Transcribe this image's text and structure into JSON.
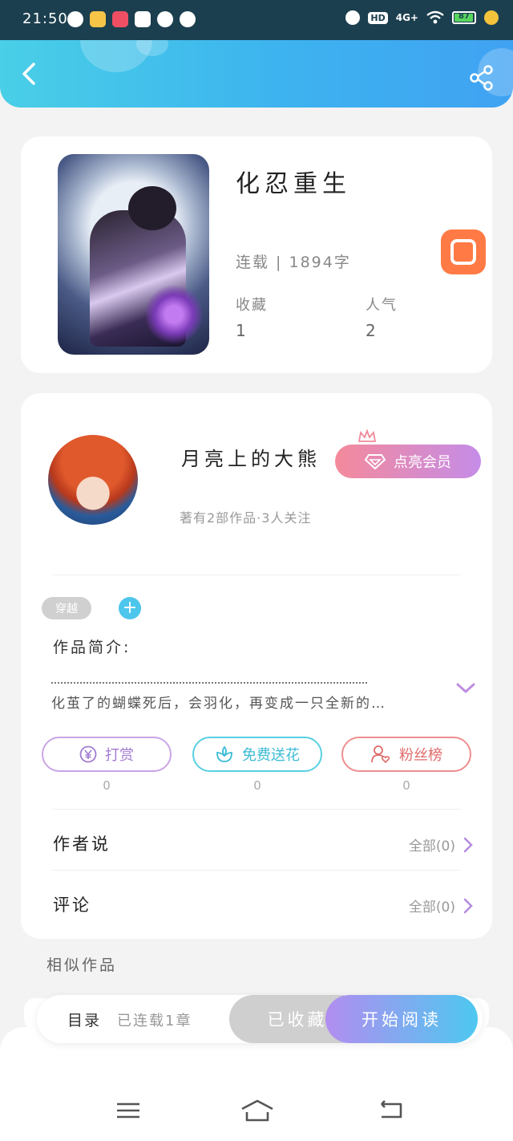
{
  "status_bar": {
    "time": "21:50",
    "network": "4G+",
    "hd": "HD",
    "battery": "87",
    "battery_fill": 0.87
  },
  "header": {
    "back_icon": "chevron-left-icon",
    "share_icon": "share-icon"
  },
  "book": {
    "title": "化忍重生",
    "meta": "连载 | 1894字",
    "stats": [
      {
        "label": "收藏",
        "value": "1"
      },
      {
        "label": "人气",
        "value": "2"
      }
    ],
    "app_badge_icon": "kuaishou-icon"
  },
  "author": {
    "name": "月亮上的大熊",
    "subtitle": "著有2部作品·3人关注",
    "vip_label": "点亮会员",
    "vip_icon": "diamond-icon",
    "crown_icon": "crown-icon"
  },
  "tags": {
    "items": [
      "穿越"
    ],
    "add_label": "+"
  },
  "intro": {
    "label": "作品简介:",
    "text": "化茧了的蝴蝶死后，会羽化，再变成一只全新的…",
    "expand_icon": "chevron-down-icon"
  },
  "actions": [
    {
      "label": "打赏",
      "icon": "yen-icon",
      "count": "0",
      "color": "#a27bd2"
    },
    {
      "label": "免费送花",
      "icon": "flower-icon",
      "count": "0",
      "color": "#3bbbd5"
    },
    {
      "label": "粉丝榜",
      "icon": "fan-user-icon",
      "count": "0",
      "color": "#e06b6b"
    }
  ],
  "rows": [
    {
      "title": "作者说",
      "link": "全部(0)"
    },
    {
      "title": "评论",
      "link": "全部(0)"
    }
  ],
  "similar_title": "相似作品",
  "bottom_bar": {
    "toc_label": "目录",
    "toc_sub": "已连载1章",
    "collected_label": "已收藏",
    "read_label": "开始阅读"
  },
  "colors": {
    "accent_blue": "#3db3ef",
    "accent_purple": "#b28df0",
    "vip_pink": "#f48a9b"
  }
}
